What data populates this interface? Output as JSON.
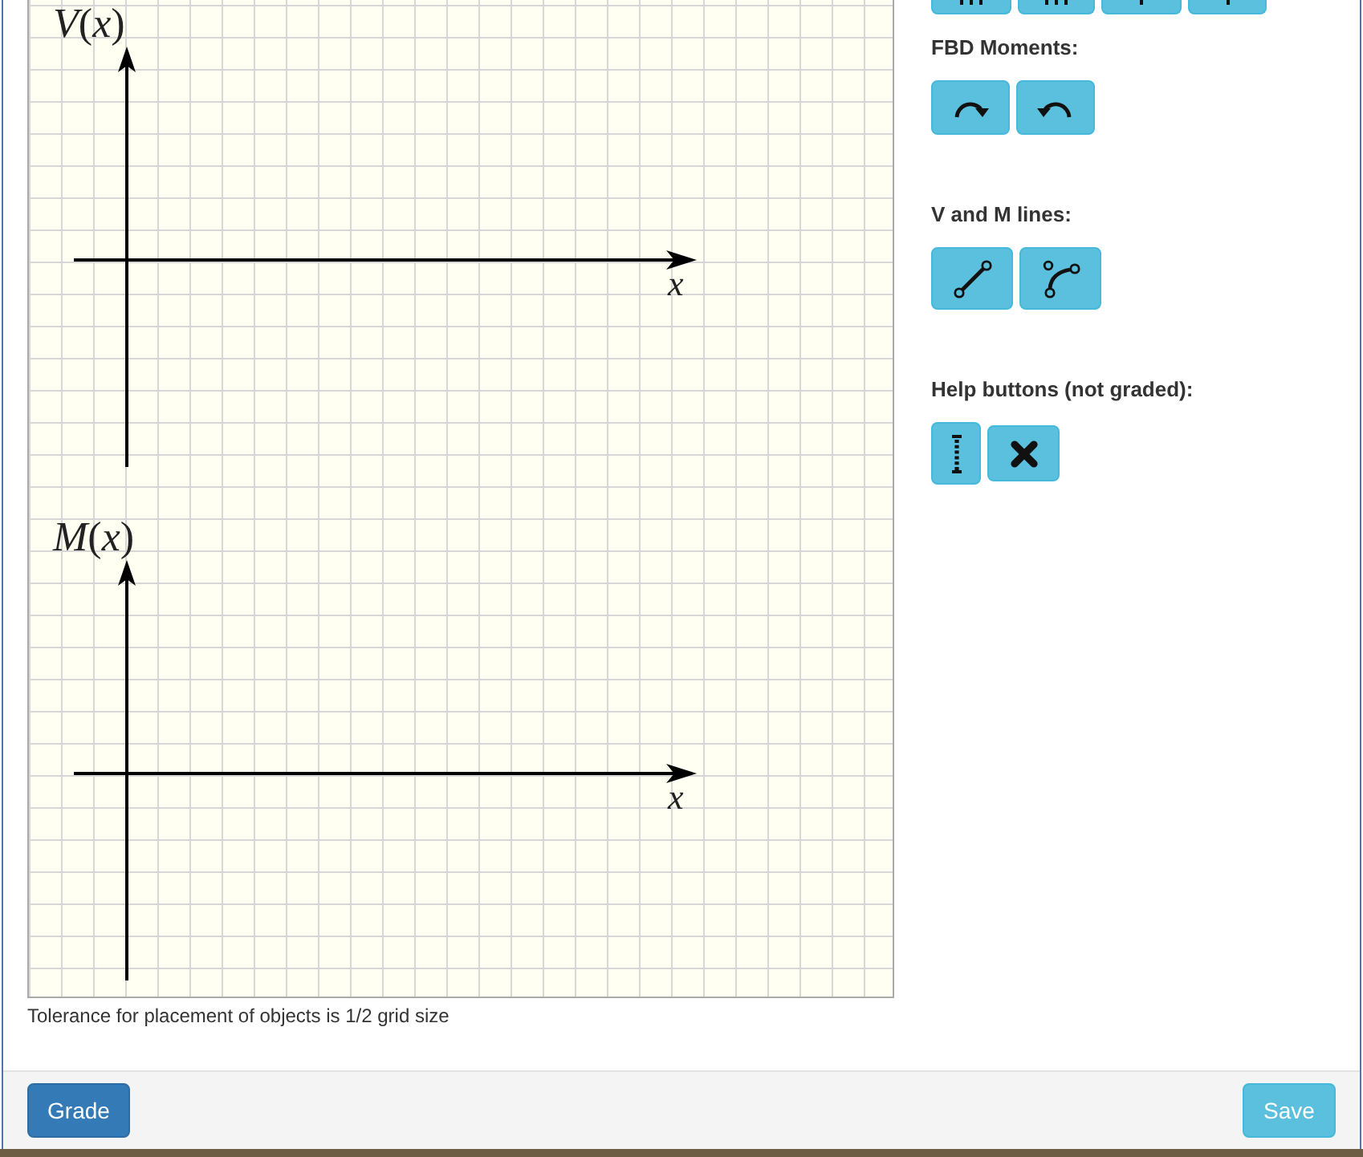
{
  "graph": {
    "plots": [
      {
        "y_label": "*V*(*x*)",
        "x_label": "x"
      },
      {
        "y_label": "*M*(*x*)",
        "x_label": "x"
      }
    ],
    "note": "Tolerance for placement of objects is 1/2 grid size"
  },
  "tools": {
    "cut_off_buttons": [
      {
        "kind": "triple"
      },
      {
        "kind": "triple"
      },
      {
        "kind": "single"
      },
      {
        "kind": "single"
      }
    ],
    "sections": [
      {
        "title": "FBD Moments:",
        "buttons": [
          {
            "kind": "clockwise"
          },
          {
            "kind": "counterclockwise"
          }
        ]
      },
      {
        "title": "V and M lines:",
        "buttons": [
          {
            "kind": "line"
          },
          {
            "kind": "curve"
          }
        ]
      },
      {
        "title": "Help buttons (not graded):",
        "buttons": [
          {
            "kind": "dotted"
          },
          {
            "kind": "cross"
          }
        ]
      }
    ]
  },
  "footer": {
    "buttons": [
      {
        "label": "Grade",
        "kind": "primary"
      },
      {
        "label": "Save",
        "kind": "info"
      }
    ]
  }
}
